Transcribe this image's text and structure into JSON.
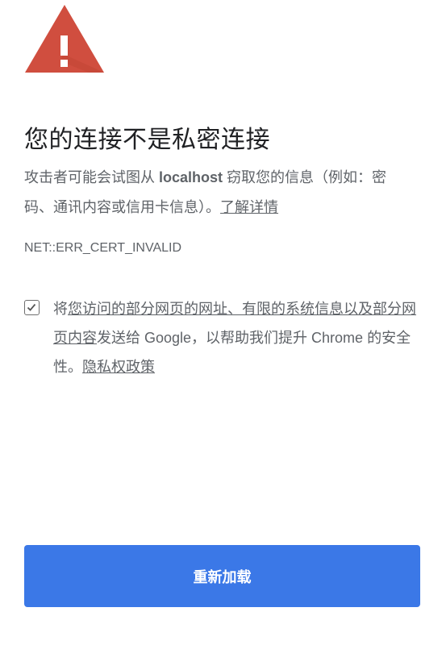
{
  "icon": "warning-triangle-icon",
  "title": "您的连接不是私密连接",
  "description": {
    "prefix": "攻击者可能会试图从 ",
    "host": "localhost",
    "suffix": " 窃取您的信息（例如：密码、通讯内容或信用卡信息）。",
    "learn_more": "了解详情"
  },
  "error_code": "NET::ERR_CERT_INVALID",
  "opt_in": {
    "checked": true,
    "prefix": "将",
    "link": "您访问的部分网页的网址、有限的系统信息以及部分网页内容",
    "middle": "发送给 Google，以帮助我们提升 Chrome 的安全性。",
    "privacy_link": "隐私权政策"
  },
  "reload_button": "重新加载",
  "colors": {
    "warning": "#d04e3f",
    "button": "#3b78e7"
  }
}
